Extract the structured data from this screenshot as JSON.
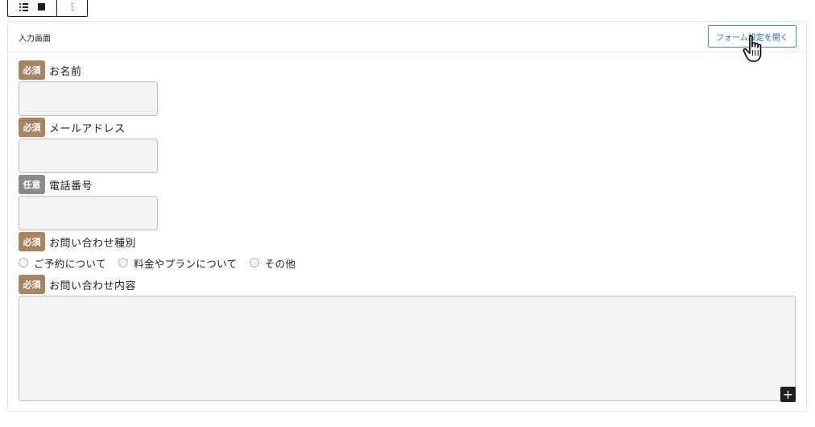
{
  "toolbar": {
    "list_icon": "list-view-icon",
    "block_icon": "square-block-icon",
    "more_label": "⋮"
  },
  "form": {
    "title": "入力画面",
    "open_settings_label": "フォーム設定を開く",
    "required_badge": "必須",
    "optional_badge": "任意",
    "fields": {
      "name": {
        "label": "お名前",
        "required": true,
        "value": ""
      },
      "email": {
        "label": "メールアドレス",
        "required": true,
        "value": ""
      },
      "phone": {
        "label": "電話番号",
        "required": false,
        "value": ""
      },
      "inquiry_type": {
        "label": "お問い合わせ種別",
        "required": true,
        "options": [
          "ご予約について",
          "料金やプランについて",
          "その他"
        ]
      },
      "message": {
        "label": "お問い合わせ内容",
        "required": true,
        "value": ""
      }
    },
    "add_block_label": "+"
  },
  "colors": {
    "required_badge": "#a88462",
    "optional_badge": "#8a8a8a",
    "accent": "#2271b1",
    "input_bg": "#f3f3f3"
  }
}
